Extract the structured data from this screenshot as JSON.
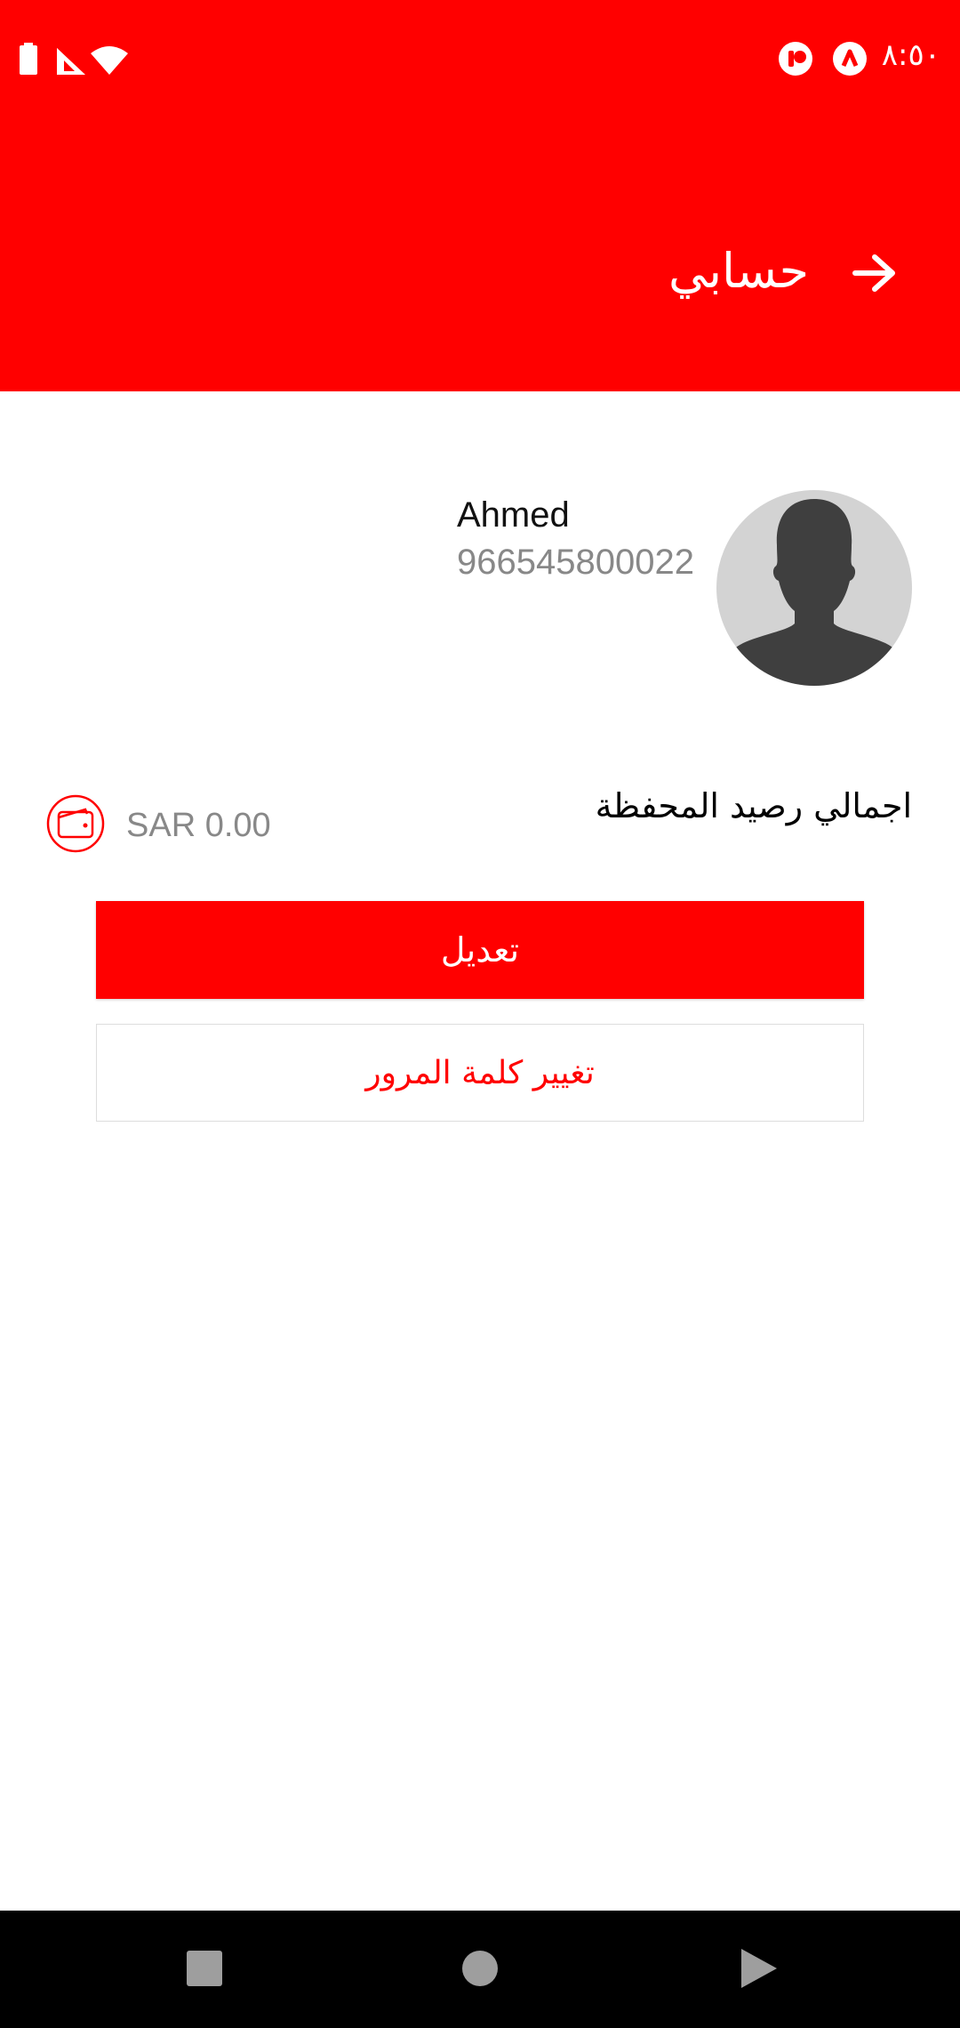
{
  "status_bar": {
    "time": "٨:٥٠"
  },
  "header": {
    "title": "حسابي"
  },
  "profile": {
    "name": "Ahmed",
    "phone": "966545800022"
  },
  "wallet": {
    "label": "اجمالي رصيد المحفظة",
    "amount": "SAR 0.00"
  },
  "actions": {
    "edit_label": "تعديل",
    "change_password_label": "تغيير كلمة المرور"
  },
  "colors": {
    "primary": "#ff0000",
    "text_secondary": "#888888",
    "nav_bar": "#000000"
  },
  "icons": {
    "back": "arrow-right-icon",
    "wallet": "wallet-icon",
    "avatar": "person-silhouette-icon",
    "battery": "battery-icon",
    "signal": "signal-icon",
    "wifi": "wifi-icon",
    "notif1": "app-notification-icon",
    "notif2": "app-notification-icon",
    "nav_recent": "square-icon",
    "nav_home": "circle-icon",
    "nav_back": "triangle-icon"
  }
}
